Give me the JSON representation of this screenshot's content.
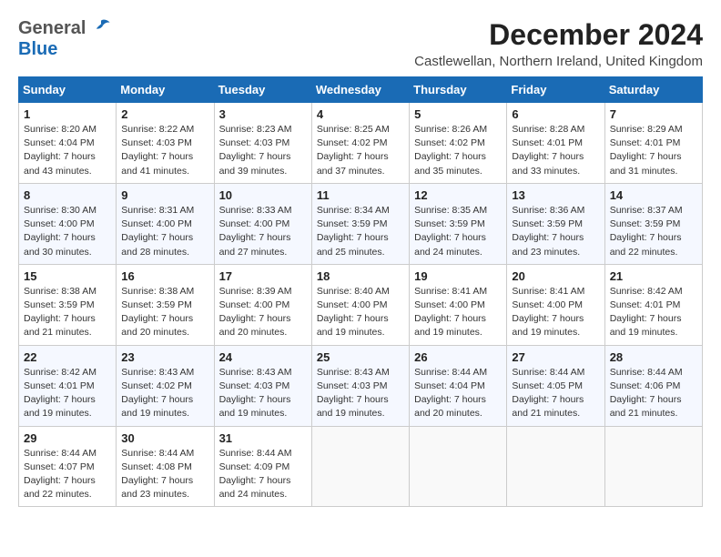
{
  "header": {
    "logo_general": "General",
    "logo_blue": "Blue",
    "month_title": "December 2024",
    "location": "Castlewellan, Northern Ireland, United Kingdom"
  },
  "weekdays": [
    "Sunday",
    "Monday",
    "Tuesday",
    "Wednesday",
    "Thursday",
    "Friday",
    "Saturday"
  ],
  "weeks": [
    [
      {
        "day": 1,
        "lines": [
          "Sunrise: 8:20 AM",
          "Sunset: 4:04 PM",
          "Daylight: 7 hours",
          "and 43 minutes."
        ]
      },
      {
        "day": 2,
        "lines": [
          "Sunrise: 8:22 AM",
          "Sunset: 4:03 PM",
          "Daylight: 7 hours",
          "and 41 minutes."
        ]
      },
      {
        "day": 3,
        "lines": [
          "Sunrise: 8:23 AM",
          "Sunset: 4:03 PM",
          "Daylight: 7 hours",
          "and 39 minutes."
        ]
      },
      {
        "day": 4,
        "lines": [
          "Sunrise: 8:25 AM",
          "Sunset: 4:02 PM",
          "Daylight: 7 hours",
          "and 37 minutes."
        ]
      },
      {
        "day": 5,
        "lines": [
          "Sunrise: 8:26 AM",
          "Sunset: 4:02 PM",
          "Daylight: 7 hours",
          "and 35 minutes."
        ]
      },
      {
        "day": 6,
        "lines": [
          "Sunrise: 8:28 AM",
          "Sunset: 4:01 PM",
          "Daylight: 7 hours",
          "and 33 minutes."
        ]
      },
      {
        "day": 7,
        "lines": [
          "Sunrise: 8:29 AM",
          "Sunset: 4:01 PM",
          "Daylight: 7 hours",
          "and 31 minutes."
        ]
      }
    ],
    [
      {
        "day": 8,
        "lines": [
          "Sunrise: 8:30 AM",
          "Sunset: 4:00 PM",
          "Daylight: 7 hours",
          "and 30 minutes."
        ]
      },
      {
        "day": 9,
        "lines": [
          "Sunrise: 8:31 AM",
          "Sunset: 4:00 PM",
          "Daylight: 7 hours",
          "and 28 minutes."
        ]
      },
      {
        "day": 10,
        "lines": [
          "Sunrise: 8:33 AM",
          "Sunset: 4:00 PM",
          "Daylight: 7 hours",
          "and 27 minutes."
        ]
      },
      {
        "day": 11,
        "lines": [
          "Sunrise: 8:34 AM",
          "Sunset: 3:59 PM",
          "Daylight: 7 hours",
          "and 25 minutes."
        ]
      },
      {
        "day": 12,
        "lines": [
          "Sunrise: 8:35 AM",
          "Sunset: 3:59 PM",
          "Daylight: 7 hours",
          "and 24 minutes."
        ]
      },
      {
        "day": 13,
        "lines": [
          "Sunrise: 8:36 AM",
          "Sunset: 3:59 PM",
          "Daylight: 7 hours",
          "and 23 minutes."
        ]
      },
      {
        "day": 14,
        "lines": [
          "Sunrise: 8:37 AM",
          "Sunset: 3:59 PM",
          "Daylight: 7 hours",
          "and 22 minutes."
        ]
      }
    ],
    [
      {
        "day": 15,
        "lines": [
          "Sunrise: 8:38 AM",
          "Sunset: 3:59 PM",
          "Daylight: 7 hours",
          "and 21 minutes."
        ]
      },
      {
        "day": 16,
        "lines": [
          "Sunrise: 8:38 AM",
          "Sunset: 3:59 PM",
          "Daylight: 7 hours",
          "and 20 minutes."
        ]
      },
      {
        "day": 17,
        "lines": [
          "Sunrise: 8:39 AM",
          "Sunset: 4:00 PM",
          "Daylight: 7 hours",
          "and 20 minutes."
        ]
      },
      {
        "day": 18,
        "lines": [
          "Sunrise: 8:40 AM",
          "Sunset: 4:00 PM",
          "Daylight: 7 hours",
          "and 19 minutes."
        ]
      },
      {
        "day": 19,
        "lines": [
          "Sunrise: 8:41 AM",
          "Sunset: 4:00 PM",
          "Daylight: 7 hours",
          "and 19 minutes."
        ]
      },
      {
        "day": 20,
        "lines": [
          "Sunrise: 8:41 AM",
          "Sunset: 4:00 PM",
          "Daylight: 7 hours",
          "and 19 minutes."
        ]
      },
      {
        "day": 21,
        "lines": [
          "Sunrise: 8:42 AM",
          "Sunset: 4:01 PM",
          "Daylight: 7 hours",
          "and 19 minutes."
        ]
      }
    ],
    [
      {
        "day": 22,
        "lines": [
          "Sunrise: 8:42 AM",
          "Sunset: 4:01 PM",
          "Daylight: 7 hours",
          "and 19 minutes."
        ]
      },
      {
        "day": 23,
        "lines": [
          "Sunrise: 8:43 AM",
          "Sunset: 4:02 PM",
          "Daylight: 7 hours",
          "and 19 minutes."
        ]
      },
      {
        "day": 24,
        "lines": [
          "Sunrise: 8:43 AM",
          "Sunset: 4:03 PM",
          "Daylight: 7 hours",
          "and 19 minutes."
        ]
      },
      {
        "day": 25,
        "lines": [
          "Sunrise: 8:43 AM",
          "Sunset: 4:03 PM",
          "Daylight: 7 hours",
          "and 19 minutes."
        ]
      },
      {
        "day": 26,
        "lines": [
          "Sunrise: 8:44 AM",
          "Sunset: 4:04 PM",
          "Daylight: 7 hours",
          "and 20 minutes."
        ]
      },
      {
        "day": 27,
        "lines": [
          "Sunrise: 8:44 AM",
          "Sunset: 4:05 PM",
          "Daylight: 7 hours",
          "and 21 minutes."
        ]
      },
      {
        "day": 28,
        "lines": [
          "Sunrise: 8:44 AM",
          "Sunset: 4:06 PM",
          "Daylight: 7 hours",
          "and 21 minutes."
        ]
      }
    ],
    [
      {
        "day": 29,
        "lines": [
          "Sunrise: 8:44 AM",
          "Sunset: 4:07 PM",
          "Daylight: 7 hours",
          "and 22 minutes."
        ]
      },
      {
        "day": 30,
        "lines": [
          "Sunrise: 8:44 AM",
          "Sunset: 4:08 PM",
          "Daylight: 7 hours",
          "and 23 minutes."
        ]
      },
      {
        "day": 31,
        "lines": [
          "Sunrise: 8:44 AM",
          "Sunset: 4:09 PM",
          "Daylight: 7 hours",
          "and 24 minutes."
        ]
      },
      null,
      null,
      null,
      null
    ]
  ]
}
